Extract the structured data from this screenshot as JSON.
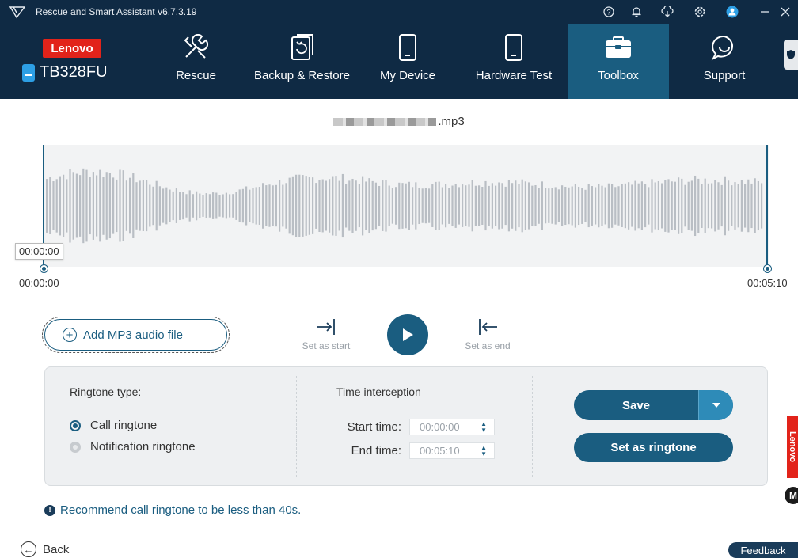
{
  "window": {
    "title": "Rescue and Smart Assistant v6.7.3.19",
    "controls": [
      "help-icon",
      "bell-icon",
      "cloud-download-icon",
      "settings-icon",
      "user-icon",
      "minimize-icon",
      "close-icon"
    ]
  },
  "brand": {
    "logo_text": "Lenovo",
    "device": "TB328FU"
  },
  "nav": {
    "items": [
      {
        "label": "Rescue",
        "icon": "wrench-screwdriver-icon"
      },
      {
        "label": "Backup & Restore",
        "icon": "backup-restore-icon"
      },
      {
        "label": "My Device",
        "icon": "tablet-icon"
      },
      {
        "label": "Hardware Test",
        "icon": "tablet-icon"
      },
      {
        "label": "Toolbox",
        "icon": "toolbox-icon",
        "active": true
      },
      {
        "label": "Support",
        "icon": "chat-bubble-icon"
      }
    ]
  },
  "player": {
    "file_name_suffix": ".mp3",
    "selection_tooltip": "00:00:00",
    "start_time": "00:00:00",
    "end_time": "00:05:10"
  },
  "controls": {
    "add_file": "Add MP3 audio file",
    "set_start": "Set as start",
    "set_end": "Set as end"
  },
  "settings": {
    "ringtone_type_label": "Ringtone type:",
    "options": [
      {
        "label": "Call ringtone",
        "selected": true
      },
      {
        "label": "Notification ringtone",
        "selected": false
      }
    ],
    "time_interception_label": "Time interception",
    "start_time_label": "Start time:",
    "start_time_value": "00:00:00",
    "end_time_label": "End time:",
    "end_time_value": "00:05:10",
    "save_label": "Save",
    "set_ringtone_label": "Set as ringtone"
  },
  "notice": "Recommend call ringtone to be less than 40s.",
  "footer": {
    "back": "Back",
    "feedback": "Feedback"
  },
  "side": {
    "lenovo": "Lenovo",
    "moto": "M"
  },
  "colors": {
    "primary": "#1a5d80",
    "navbar": "#0f2a44",
    "lenovo_red": "#e2231a",
    "waveform": "#b9bec4"
  }
}
